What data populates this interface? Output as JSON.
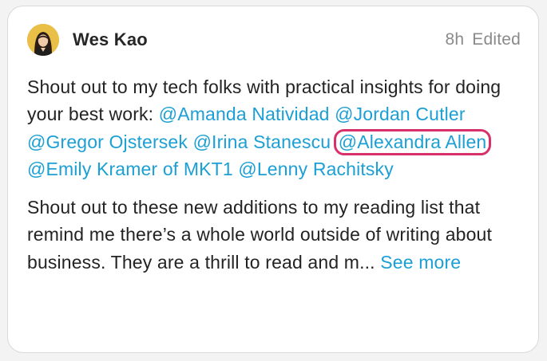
{
  "post": {
    "author": "Wes Kao",
    "time": "8h",
    "edited": "Edited",
    "para1_text": "Shout out to my tech folks with practical insights for doing your best work:",
    "mentions": [
      "@Amanda Natividad",
      "@Jordan Cutler",
      "@Gregor Ojstersek",
      "@Irina Stanescu",
      "@Alexandra Allen",
      "@Emily Kramer of MKT1",
      "@Lenny Rachitsky"
    ],
    "highlight_color": "#d8306b",
    "para2_text": "Shout out to these new additions to my reading list that remind me there’s a whole world outside of writing about business. They are a thrill to read and m...",
    "see_more": "See more",
    "link_color": "#1b9fd4"
  }
}
